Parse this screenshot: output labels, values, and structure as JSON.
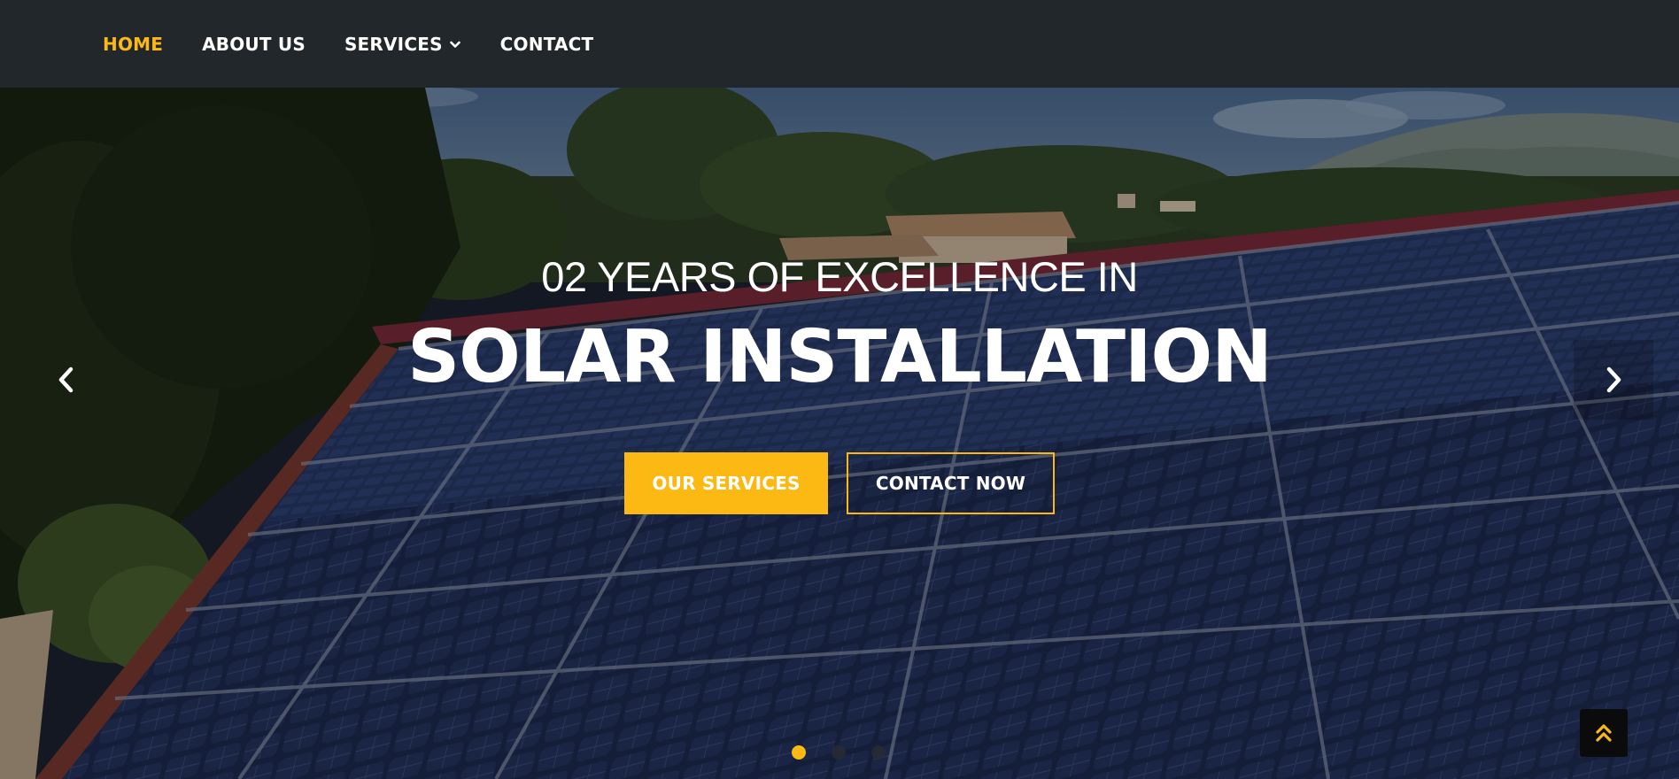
{
  "nav": {
    "items": [
      {
        "label": "HOME",
        "active": true
      },
      {
        "label": "ABOUT US",
        "active": false
      },
      {
        "label": "SERVICES",
        "active": false,
        "has_dropdown": true
      },
      {
        "label": "CONTACT",
        "active": false
      }
    ]
  },
  "hero": {
    "subtitle": "02 YEARS OF EXCELLENCE IN",
    "title": "SOLAR INSTALLATION",
    "primary_button": "OUR SERVICES",
    "secondary_button": "CONTACT NOW",
    "slides": 3,
    "active_slide": 1
  },
  "icons": {
    "prev": "chevron-left-icon",
    "next": "chevron-right-icon",
    "dropdown": "chevron-down-icon",
    "back_to_top": "double-chevron-up-icon"
  },
  "colors": {
    "accent": "#fdb913",
    "navbar": "#22272c",
    "text": "#ffffff"
  }
}
